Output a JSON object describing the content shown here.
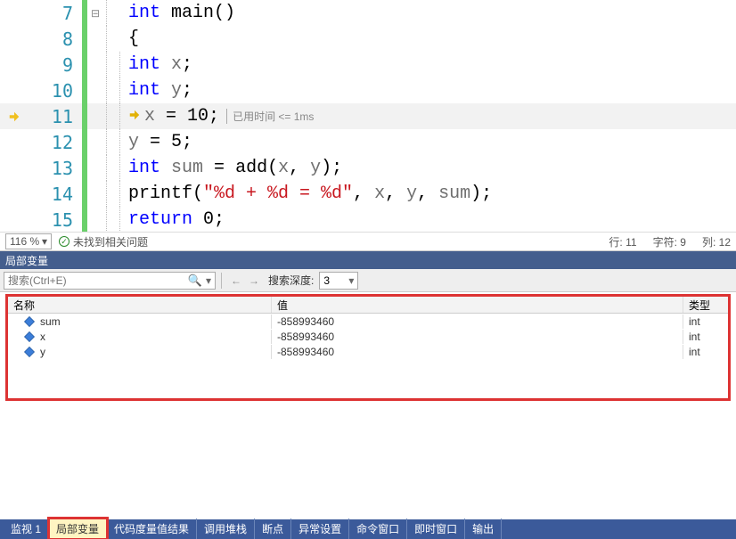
{
  "editor": {
    "lines": [
      {
        "n": 7,
        "indent": 0,
        "fold": true,
        "tokens": [
          {
            "c": "kw",
            "t": "int"
          },
          {
            "c": "",
            "t": " main()"
          }
        ]
      },
      {
        "n": 8,
        "indent": 0,
        "tokens": [
          {
            "c": "",
            "t": "{"
          }
        ]
      },
      {
        "n": 9,
        "indent": 1,
        "tokens": [
          {
            "c": "kw",
            "t": "int"
          },
          {
            "c": "",
            "t": " "
          },
          {
            "c": "id",
            "t": "x"
          },
          {
            "c": "",
            "t": ";"
          }
        ]
      },
      {
        "n": 10,
        "indent": 1,
        "tokens": [
          {
            "c": "kw",
            "t": "int"
          },
          {
            "c": "",
            "t": " "
          },
          {
            "c": "id",
            "t": "y"
          },
          {
            "c": "",
            "t": ";"
          }
        ]
      },
      {
        "n": 11,
        "indent": 1,
        "current": true,
        "exec": true,
        "tokens": [
          {
            "c": "id",
            "t": "x"
          },
          {
            "c": "",
            "t": " = "
          },
          {
            "c": "num",
            "t": "10"
          },
          {
            "c": "",
            "t": ";"
          }
        ],
        "tip": "已用时间 <= 1ms"
      },
      {
        "n": 12,
        "indent": 1,
        "tokens": [
          {
            "c": "id",
            "t": "y"
          },
          {
            "c": "",
            "t": " = "
          },
          {
            "c": "num",
            "t": "5"
          },
          {
            "c": "",
            "t": ";"
          }
        ]
      },
      {
        "n": 13,
        "indent": 1,
        "tokens": [
          {
            "c": "kw",
            "t": "int"
          },
          {
            "c": "",
            "t": " "
          },
          {
            "c": "id",
            "t": "sum"
          },
          {
            "c": "",
            "t": " = "
          },
          {
            "c": "fn",
            "t": "add"
          },
          {
            "c": "",
            "t": "("
          },
          {
            "c": "id",
            "t": "x"
          },
          {
            "c": "",
            "t": ", "
          },
          {
            "c": "id",
            "t": "y"
          },
          {
            "c": "",
            "t": ");"
          }
        ]
      },
      {
        "n": 14,
        "indent": 1,
        "tokens": [
          {
            "c": "fn",
            "t": "printf"
          },
          {
            "c": "",
            "t": "("
          },
          {
            "c": "str",
            "t": "\"%d + %d = %d\""
          },
          {
            "c": "",
            "t": ", "
          },
          {
            "c": "id",
            "t": "x"
          },
          {
            "c": "",
            "t": ", "
          },
          {
            "c": "id",
            "t": "y"
          },
          {
            "c": "",
            "t": ", "
          },
          {
            "c": "id",
            "t": "sum"
          },
          {
            "c": "",
            "t": ");"
          }
        ]
      },
      {
        "n": 15,
        "indent": 1,
        "tokens": [
          {
            "c": "kw",
            "t": "return"
          },
          {
            "c": "",
            "t": " "
          },
          {
            "c": "num",
            "t": "0"
          },
          {
            "c": "",
            "t": ";"
          }
        ]
      }
    ]
  },
  "status": {
    "zoom": "116 %",
    "issues": "未找到相关问题",
    "line_label": "行:",
    "line_val": "11",
    "char_label": "字符:",
    "char_val": "9",
    "col_label": "列:",
    "col_val": "12"
  },
  "locals": {
    "title": "局部变量",
    "search_placeholder": "搜索(Ctrl+E)",
    "depth_label": "搜索深度:",
    "depth_value": "3",
    "columns": {
      "name": "名称",
      "value": "值",
      "type": "类型"
    },
    "rows": [
      {
        "name": "sum",
        "value": "-858993460",
        "type": "int"
      },
      {
        "name": "x",
        "value": "-858993460",
        "type": "int"
      },
      {
        "name": "y",
        "value": "-858993460",
        "type": "int"
      }
    ]
  },
  "tabs": [
    {
      "label": "监视 1",
      "active": false
    },
    {
      "label": "局部变量",
      "active": true,
      "boxed": true
    },
    {
      "label": "代码度量值结果",
      "active": false
    },
    {
      "label": "调用堆栈",
      "active": false
    },
    {
      "label": "断点",
      "active": false
    },
    {
      "label": "异常设置",
      "active": false
    },
    {
      "label": "命令窗口",
      "active": false
    },
    {
      "label": "即时窗口",
      "active": false
    },
    {
      "label": "输出",
      "active": false
    }
  ]
}
